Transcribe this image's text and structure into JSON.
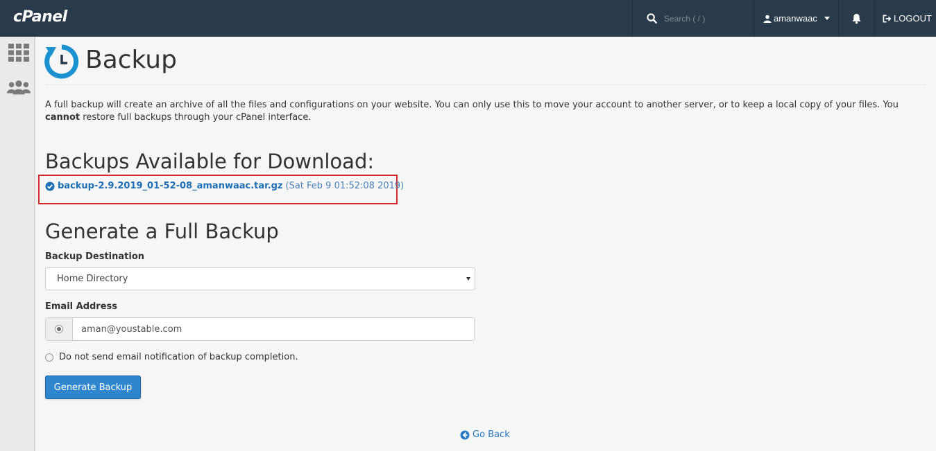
{
  "header": {
    "logo": "cPanel",
    "search_placeholder": "Search ( / )",
    "username": "amanwaac",
    "logout_label": "LOGOUT"
  },
  "sidebar": {
    "items": [
      {
        "icon": "grid-icon",
        "label": "Home"
      },
      {
        "icon": "users-icon",
        "label": "Users"
      }
    ]
  },
  "page": {
    "title": "Backup",
    "intro_part1": "A full backup will create an archive of all the files and configurations on your website. You can only use this to move your account to another server, or to keep a local copy of your files. You",
    "intro_bold": "cannot",
    "intro_part2": "restore full backups through your cPanel interface."
  },
  "backups": {
    "heading": "Backups Available for Download:",
    "items": [
      {
        "filename": "backup-2.9.2019_01-52-08_amanwaac.tar.gz",
        "date": "(Sat Feb 9 01:52:08 2019)"
      }
    ]
  },
  "generate": {
    "heading": "Generate a Full Backup",
    "destination_label": "Backup Destination",
    "destination_value": "Home Directory",
    "email_label": "Email Address",
    "email_value": "aman@youstable.com",
    "no_email_label": "Do not send email notification of backup completion.",
    "button_label": "Generate Backup"
  },
  "footer": {
    "go_back": "Go Back"
  },
  "colors": {
    "topbar": "#293a4a",
    "accent": "#2f86cd",
    "link": "#1d6fb6",
    "highlight": "#d52a2a"
  }
}
